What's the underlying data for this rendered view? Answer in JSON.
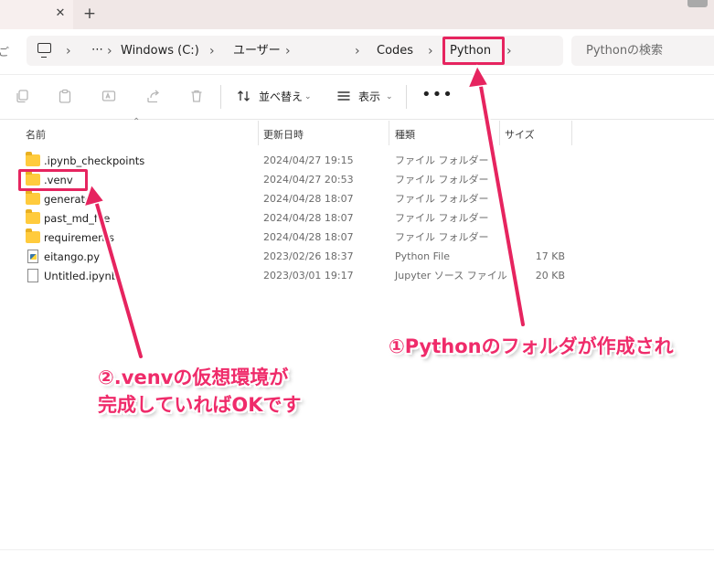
{
  "tabbar": {
    "close_glyph": "✕",
    "new_tab_glyph": "+"
  },
  "address": {
    "back_partial": "ご",
    "overflow": "⋯",
    "crumbs": [
      "Windows (C:)",
      "ユーザー",
      "Codes",
      "Python"
    ],
    "separator": "›",
    "search_placeholder": "Pythonの検索"
  },
  "toolbar": {
    "sort_label": "並べ替え",
    "view_label": "表示",
    "more": "•••",
    "icons": [
      "copy-icon",
      "paste-icon",
      "rename-icon",
      "share-icon",
      "delete-icon",
      "sort-icon",
      "view-icon"
    ]
  },
  "columns": {
    "name": "名前",
    "date": "更新日時",
    "type": "種類",
    "size": "サイズ"
  },
  "files": [
    {
      "name": ".ipynb_checkpoints",
      "date": "2024/04/27 19:15",
      "type": "ファイル フォルダー",
      "size": "",
      "kind": "folder"
    },
    {
      "name": ".venv",
      "date": "2024/04/27 20:53",
      "type": "ファイル フォルダー",
      "size": "",
      "kind": "folder"
    },
    {
      "name": "generated",
      "date": "2024/04/28 18:07",
      "type": "ファイル フォルダー",
      "size": "",
      "kind": "folder"
    },
    {
      "name": "past_md_file",
      "date": "2024/04/28 18:07",
      "type": "ファイル フォルダー",
      "size": "",
      "kind": "folder"
    },
    {
      "name": "requirements",
      "date": "2024/04/28 18:07",
      "type": "ファイル フォルダー",
      "size": "",
      "kind": "folder"
    },
    {
      "name": "eitango.py",
      "date": "2023/02/26 18:37",
      "type": "Python File",
      "size": "17 KB",
      "kind": "python"
    },
    {
      "name": "Untitled.ipynb",
      "date": "2023/03/01 19:17",
      "type": "Jupyter ソース ファイル",
      "size": "20 KB",
      "kind": "file"
    }
  ],
  "annotations": {
    "callout1": "①Pythonのフォルダが作成され",
    "callout2_line1": "②.venvの仮想環境が",
    "callout2_line2": "完成していればOKです",
    "color": "#e6245f"
  }
}
